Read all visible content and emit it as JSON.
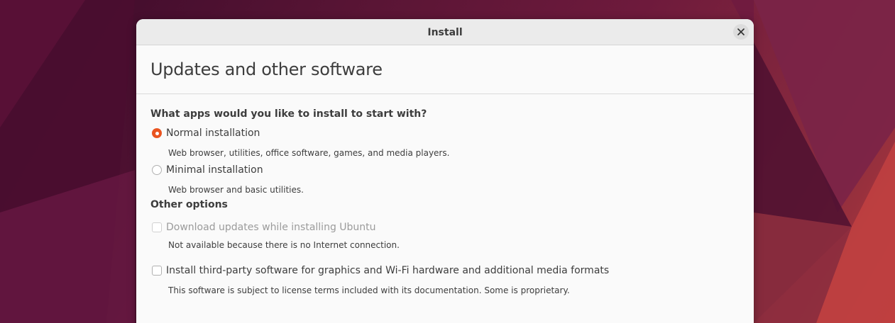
{
  "window": {
    "title": "Install",
    "close_icon": "close-icon"
  },
  "page": {
    "heading": "Updates and other software"
  },
  "apps_section": {
    "question": "What apps would you like to install to start with?",
    "options": [
      {
        "label": "Normal installation",
        "description": "Web browser, utilities, office software, games, and media players.",
        "selected": true
      },
      {
        "label": "Minimal installation",
        "description": "Web browser and basic utilities.",
        "selected": false
      }
    ]
  },
  "other_section": {
    "heading": "Other options",
    "options": [
      {
        "label": "Download updates while installing Ubuntu",
        "description": "Not available because there is no Internet connection.",
        "checked": false,
        "enabled": false
      },
      {
        "label": "Install third-party software for graphics and Wi-Fi hardware and additional media formats",
        "description": "This software is subject to license terms included with its documentation. Some is proprietary.",
        "checked": false,
        "enabled": true
      }
    ]
  },
  "colors": {
    "accent": "#e95420",
    "window_bg": "#fafafa",
    "titlebar_bg": "#ebebeb",
    "text": "#3d3d3d",
    "disabled_text": "#9b9b9b"
  }
}
